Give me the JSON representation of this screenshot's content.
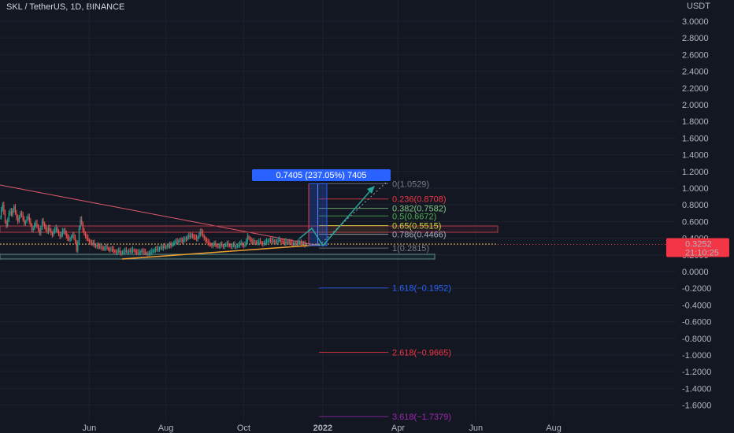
{
  "header": {
    "title": "SKL / TetherUS, 1D, BINANCE"
  },
  "chart_data": {
    "type": "candlestick",
    "currency_label": "USDT",
    "y_axis": {
      "ticks": [
        "3.0000",
        "2.8000",
        "2.6000",
        "2.4000",
        "2.2000",
        "2.0000",
        "1.8000",
        "1.6000",
        "1.4000",
        "1.2000",
        "1.0000",
        "0.8000",
        "0.6000",
        "0.4000",
        "0.2000",
        "0.0000",
        "-0.2000",
        "-0.4000",
        "-0.6000",
        "-0.8000",
        "-1.0000",
        "-1.2000",
        "-1.4000",
        "-1.6000"
      ],
      "tick_values": [
        3.0,
        2.8,
        2.6,
        2.4,
        2.2,
        2.0,
        1.8,
        1.6,
        1.4,
        1.2,
        1.0,
        0.8,
        0.6,
        0.4,
        0.2,
        0.0,
        -0.2,
        -0.4,
        -0.6,
        -0.8,
        -1.0,
        -1.2,
        -1.4,
        -1.6
      ],
      "ylim": [
        -1.72,
        3.05
      ]
    },
    "x_axis": {
      "ticks": [
        "Jun",
        "Aug",
        "Oct",
        "2022",
        "Apr",
        "Jun",
        "Aug"
      ],
      "tick_index": [
        70,
        130,
        191,
        253,
        312,
        373,
        434
      ]
    },
    "price_label": {
      "value": 0.3252,
      "text": "0.3252",
      "countdown": "21:10:25",
      "color": "#f23645"
    },
    "measure_label": {
      "text": "0.7405 (237.05%) 7405",
      "color": "#2962ff"
    },
    "fib_levels": [
      {
        "ratio": 0,
        "price": 1.0529,
        "label": "0(1.0529)",
        "color": "#787b86"
      },
      {
        "ratio": 0.236,
        "price": 0.8708,
        "label": "0.236(0.8708)",
        "color": "#f23645"
      },
      {
        "ratio": 0.382,
        "price": 0.7582,
        "label": "0.382(0.7582)",
        "color": "#81c784"
      },
      {
        "ratio": 0.5,
        "price": 0.6672,
        "label": "0.5(0.6672)",
        "color": "#4caf50"
      },
      {
        "ratio": 0.65,
        "price": 0.5515,
        "label": "0.65(0.5515)",
        "color": "#cddc39"
      },
      {
        "ratio": 0.786,
        "price": 0.4466,
        "label": "0.786(0.4466)",
        "color": "#a6b0c3"
      },
      {
        "ratio": 1,
        "price": 0.2815,
        "label": "1(0.2815)",
        "color": "#787b86"
      },
      {
        "ratio": 1.618,
        "price": -0.1952,
        "label": "1.618(−0.1952)",
        "color": "#2962ff"
      },
      {
        "ratio": 2.618,
        "price": -0.9665,
        "label": "2.618(−0.9665)",
        "color": "#f23645"
      },
      {
        "ratio": 3.618,
        "price": -1.7379,
        "label": "3.618(−1.7379)",
        "color": "#9c27b0"
      }
    ],
    "series": [
      {
        "values": [
          0.65,
          0.75,
          0.8,
          0.7,
          0.6,
          0.55,
          0.62,
          0.7,
          0.72,
          0.68,
          0.74,
          0.78,
          0.7,
          0.64,
          0.6,
          0.66,
          0.7,
          0.68,
          0.62,
          0.58,
          0.6,
          0.64,
          0.66,
          0.6,
          0.56,
          0.5,
          0.52,
          0.56,
          0.58,
          0.55,
          0.5,
          0.46,
          0.52,
          0.6,
          0.58,
          0.54,
          0.5,
          0.48,
          0.52,
          0.5,
          0.46,
          0.44,
          0.48,
          0.5,
          0.52,
          0.48,
          0.45,
          0.42,
          0.44,
          0.48,
          0.5,
          0.46,
          0.42,
          0.4,
          0.38,
          0.4,
          0.42,
          0.44,
          0.4,
          0.36,
          0.25,
          0.35,
          0.52,
          0.62,
          0.58,
          0.5,
          0.45,
          0.42,
          0.4,
          0.38,
          0.36,
          0.35,
          0.33,
          0.34,
          0.32,
          0.3,
          0.32,
          0.3,
          0.29,
          0.3,
          0.28,
          0.27,
          0.28,
          0.29,
          0.28,
          0.27,
          0.26,
          0.27,
          0.26,
          0.25,
          0.24,
          0.23,
          0.24,
          0.25,
          0.23,
          0.22,
          0.23,
          0.24,
          0.25,
          0.24,
          0.24,
          0.25,
          0.24,
          0.25,
          0.26,
          0.25,
          0.24,
          0.23,
          0.22,
          0.23,
          0.24,
          0.25,
          0.24,
          0.23,
          0.22,
          0.22,
          0.21,
          0.22,
          0.23,
          0.24,
          0.25,
          0.26,
          0.27,
          0.26,
          0.27,
          0.28,
          0.29,
          0.28,
          0.3,
          0.29,
          0.3,
          0.31,
          0.3,
          0.32,
          0.31,
          0.33,
          0.34,
          0.35,
          0.36,
          0.35,
          0.37,
          0.38,
          0.37,
          0.36,
          0.38,
          0.4,
          0.39,
          0.41,
          0.43,
          0.42,
          0.44,
          0.42,
          0.41,
          0.4,
          0.39,
          0.41,
          0.44,
          0.48,
          0.46,
          0.43,
          0.4,
          0.38,
          0.36,
          0.34,
          0.33,
          0.32,
          0.31,
          0.32,
          0.33,
          0.32,
          0.31,
          0.3,
          0.31,
          0.32,
          0.31,
          0.3,
          0.31,
          0.32,
          0.33,
          0.32,
          0.31,
          0.3,
          0.31,
          0.32,
          0.3,
          0.3,
          0.31,
          0.32,
          0.33,
          0.34,
          0.32,
          0.31,
          0.33,
          0.36,
          0.42,
          0.4,
          0.38,
          0.36,
          0.35,
          0.36,
          0.35,
          0.34,
          0.35,
          0.36,
          0.35,
          0.34,
          0.33,
          0.34,
          0.35,
          0.36,
          0.37,
          0.38,
          0.37,
          0.36,
          0.37,
          0.36,
          0.35,
          0.36,
          0.37,
          0.38,
          0.37,
          0.36,
          0.35,
          0.34,
          0.36,
          0.35,
          0.36,
          0.35,
          0.34,
          0.33,
          0.34,
          0.33,
          0.34,
          0.33,
          0.35,
          0.36,
          0.34,
          0.33,
          0.33,
          0.32,
          0.3252
        ]
      }
    ]
  }
}
